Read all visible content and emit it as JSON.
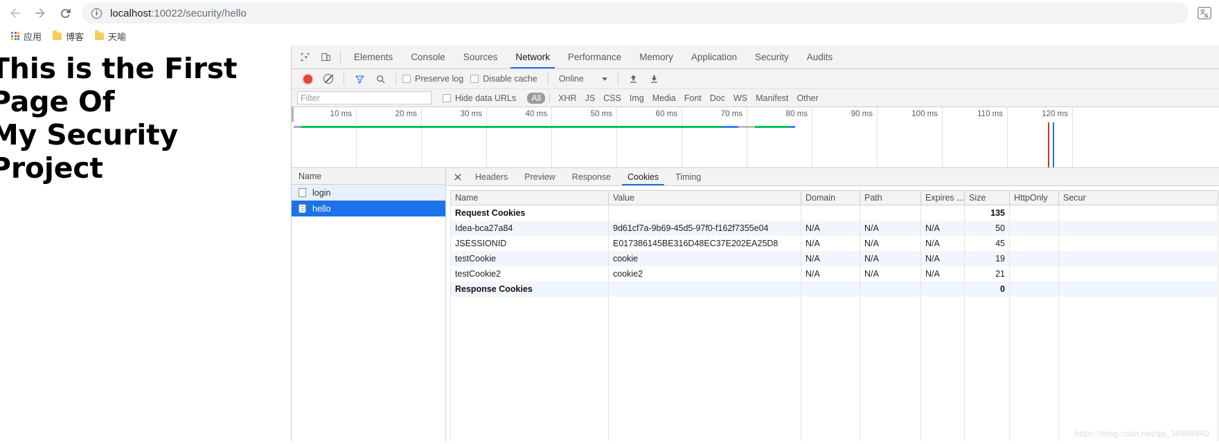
{
  "browser": {
    "back_icon": "back-arrow-icon",
    "forward_icon": "forward-arrow-icon",
    "reload_icon": "reload-icon",
    "omnibox": {
      "info_icon": "info-circle-icon",
      "url_host": "localhost",
      "url_rest": ":10022/security/hello",
      "full_url": "localhost:10022/security/hello"
    },
    "translate_icon": "translate-icon",
    "bookmarks": [
      {
        "label": "应用",
        "icon": "apps-grid-icon"
      },
      {
        "label": "博客",
        "icon": "folder-icon"
      },
      {
        "label": "天喻",
        "icon": "folder-icon"
      }
    ]
  },
  "page": {
    "heading": "This is the First Page Of\nMy Security Project"
  },
  "devtools": {
    "inspect_icon": "inspect-element-icon",
    "device_icon": "device-toolbar-icon",
    "tabs": [
      {
        "label": "Elements",
        "active": false
      },
      {
        "label": "Console",
        "active": false
      },
      {
        "label": "Sources",
        "active": false
      },
      {
        "label": "Network",
        "active": true
      },
      {
        "label": "Performance",
        "active": false
      },
      {
        "label": "Memory",
        "active": false
      },
      {
        "label": "Application",
        "active": false
      },
      {
        "label": "Security",
        "active": false
      },
      {
        "label": "Audits",
        "active": false
      }
    ],
    "toolbar": {
      "record_icon": "record-button-icon",
      "clear_icon": "clear-icon",
      "filter_icon": "funnel-filter-icon",
      "search_icon": "search-icon",
      "preserve_log_label": "Preserve log",
      "disable_cache_label": "Disable cache",
      "throttle_value": "Online",
      "import_icon": "import-har-icon",
      "export_icon": "export-har-icon"
    },
    "filter_bar": {
      "filter_placeholder": "Filter",
      "filter_value": "",
      "hide_data_urls_label": "Hide data URLs",
      "types": [
        "All",
        "XHR",
        "JS",
        "CSS",
        "Img",
        "Media",
        "Font",
        "Doc",
        "WS",
        "Manifest",
        "Other"
      ],
      "active_type": "All"
    },
    "overview": {
      "ticks": [
        "10 ms",
        "20 ms",
        "30 ms",
        "40 ms",
        "50 ms",
        "60 ms",
        "70 ms",
        "80 ms",
        "90 ms",
        "100 ms",
        "110 ms",
        "120 ms"
      ],
      "colors": {
        "network_green": "#00c853",
        "network_blue": "#3b82f6",
        "network_grey": "#bdbdbd",
        "dom_content_loaded": "#1a73e8",
        "load_event": "#d93025"
      }
    },
    "request_list": {
      "column_header": "Name",
      "rows": [
        {
          "name": "login",
          "icon": "document-icon",
          "selected": false
        },
        {
          "name": "hello",
          "icon": "document-icon",
          "selected": true
        }
      ]
    },
    "detail": {
      "close_icon": "close-icon",
      "tabs": [
        {
          "label": "Headers",
          "active": false
        },
        {
          "label": "Preview",
          "active": false
        },
        {
          "label": "Response",
          "active": false
        },
        {
          "label": "Cookies",
          "active": true
        },
        {
          "label": "Timing",
          "active": false
        }
      ],
      "cookies_table": {
        "columns": [
          "Name",
          "Value",
          "Domain",
          "Path",
          "Expires ...",
          "Size",
          "HttpOnly",
          "Secur"
        ],
        "rows": [
          {
            "type": "group",
            "name": "Request Cookies",
            "value": "",
            "domain": "",
            "path": "",
            "expires": "",
            "size": "135",
            "httponly": "",
            "secure": ""
          },
          {
            "type": "cookie",
            "name": "Idea-bca27a84",
            "value": "9d61cf7a-9b69-45d5-97f0-f162f7355e04",
            "domain": "N/A",
            "path": "N/A",
            "expires": "N/A",
            "size": "50",
            "httponly": "",
            "secure": ""
          },
          {
            "type": "cookie",
            "name": "JSESSIONID",
            "value": "E017386145BE316D48EC37E202EA25D8",
            "domain": "N/A",
            "path": "N/A",
            "expires": "N/A",
            "size": "45",
            "httponly": "",
            "secure": ""
          },
          {
            "type": "cookie",
            "name": "testCookie",
            "value": "cookie",
            "domain": "N/A",
            "path": "N/A",
            "expires": "N/A",
            "size": "19",
            "httponly": "",
            "secure": ""
          },
          {
            "type": "cookie",
            "name": "testCookie2",
            "value": "cookie2",
            "domain": "N/A",
            "path": "N/A",
            "expires": "N/A",
            "size": "21",
            "httponly": "",
            "secure": ""
          },
          {
            "type": "group",
            "name": "Response Cookies",
            "value": "",
            "domain": "",
            "path": "",
            "expires": "",
            "size": "0",
            "httponly": "",
            "secure": ""
          }
        ]
      }
    }
  },
  "watermark": "https://blog.csdn.net/qq_34988940"
}
